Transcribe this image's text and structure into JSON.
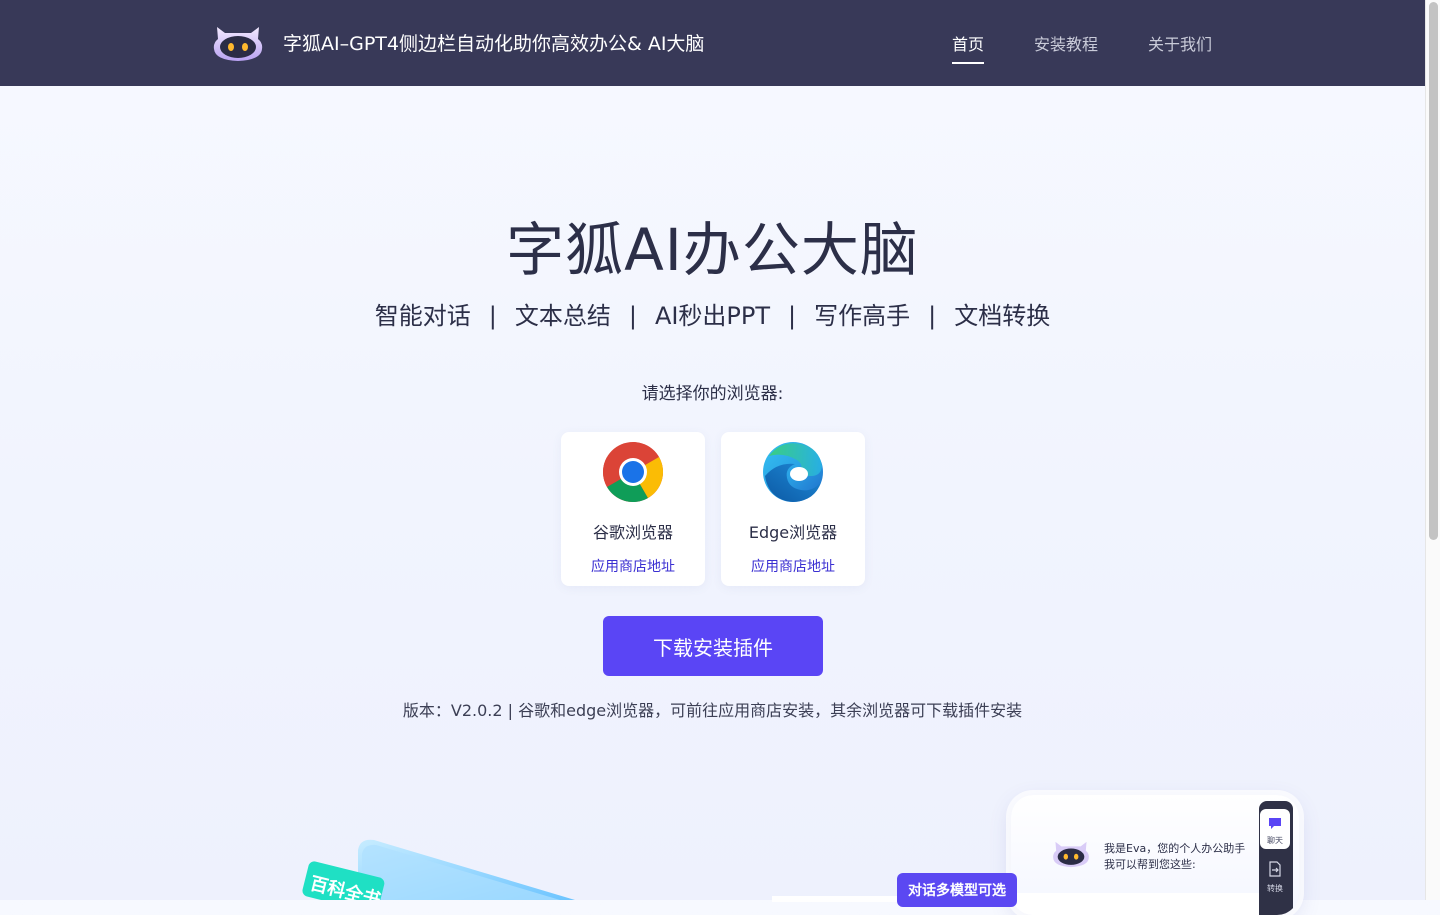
{
  "header": {
    "site_title": "字狐AI–GPT4侧边栏自动化助你高效办公& AI大脑",
    "nav": {
      "home": "首页",
      "install_guide": "安装教程",
      "about": "关于我们"
    },
    "active_nav": "home"
  },
  "hero": {
    "title": "字狐AI办公大脑",
    "features": [
      "智能对话",
      "文本总结",
      "AI秒出PPT",
      "写作高手",
      "文档转换"
    ],
    "feature_separator": "|"
  },
  "browser_select": {
    "label": "请选择你的浏览器:",
    "browsers": [
      {
        "name": "谷歌浏览器",
        "link_text": "应用商店地址",
        "icon": "chrome-icon"
      },
      {
        "name": "Edge浏览器",
        "link_text": "应用商店地址",
        "icon": "edge-icon"
      }
    ]
  },
  "download": {
    "button_label": "下载安装插件",
    "version_note": "版本：V2.0.2 | 谷歌和edge浏览器，可前往应用商店安装，其余浏览器可下载插件安装"
  },
  "showcase": {
    "left_tag": "百科全书",
    "badge": "对话多模型可选",
    "assistant_greeting_line1": "我是Eva，您的个人办公助手",
    "assistant_greeting_line2": "我可以帮到您这些:",
    "rail_chat_label": "聊天",
    "rail_convert_label": "转换"
  },
  "colors": {
    "header_bg": "#383958",
    "primary": "#5a45f5",
    "link": "#3a2fd2",
    "text_dark": "#2c2f48"
  }
}
